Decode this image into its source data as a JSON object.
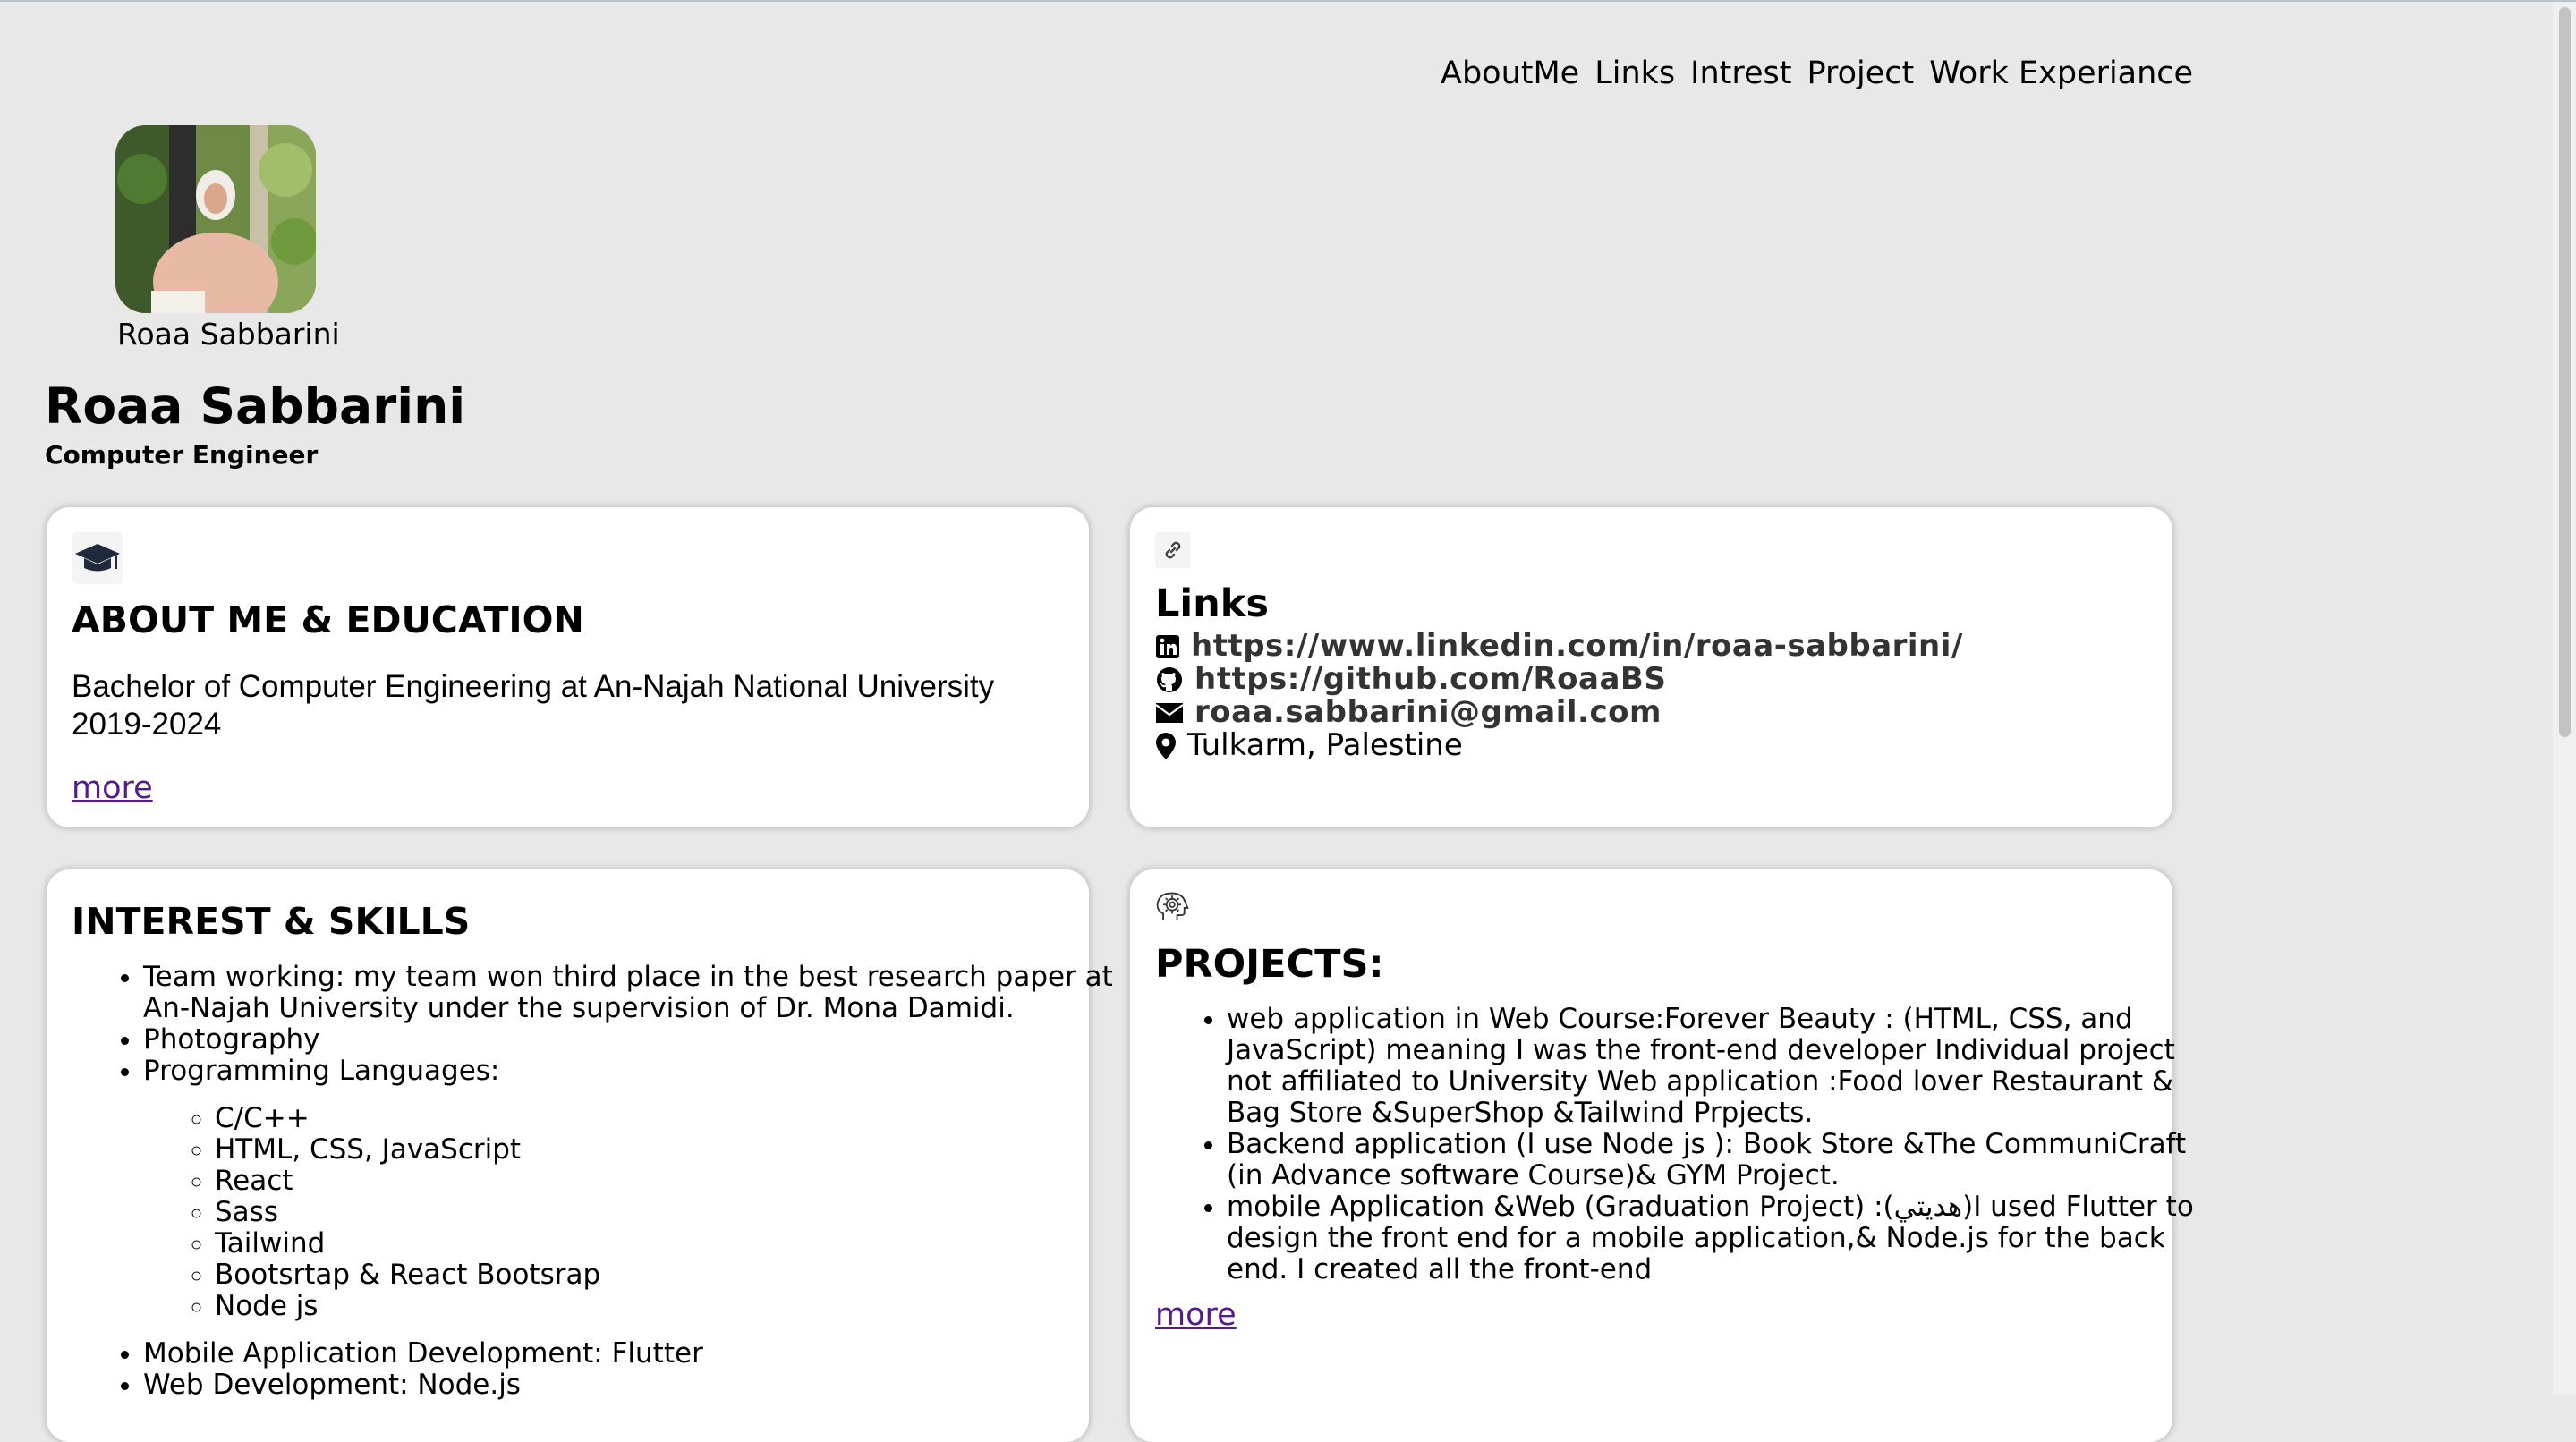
{
  "nav": {
    "items": [
      "AboutMe",
      "Links",
      "Intrest",
      "Project",
      "Work Experiance"
    ]
  },
  "profile": {
    "avatar_caption": "Roaa Sabbarini",
    "name": "Roaa Sabbarini",
    "title": "Computer Engineer"
  },
  "about": {
    "heading": "ABOUT ME & EDUCATION",
    "text": "Bachelor of Computer Engineering at An-Najah National University 2019-2024",
    "more": "more"
  },
  "links": {
    "heading": "Links",
    "linkedin": "https://www.linkedin.com/in/roaa-sabbarini/",
    "github": "https://github.com/RoaaBS",
    "email": "roaa.sabbarini@gmail.com",
    "location": "Tulkarm, Palestine"
  },
  "interest": {
    "heading": "INTEREST & SKILLS",
    "items": [
      "Team working: my team won third place in the best research paper at An-Najah University under the supervision of Dr. Mona Damidi.",
      "Photography",
      "Programming Languages:"
    ],
    "languages": [
      "C/C++",
      "HTML, CSS, JavaScript",
      "React",
      "Sass",
      "Tailwind",
      "Bootsrtap & React Bootsrap",
      "Node js"
    ],
    "items_after": [
      "Mobile Application Development: Flutter",
      "Web Development: Node.js"
    ]
  },
  "projects": {
    "heading": "PROJECTS:",
    "items": [
      "web application in Web Course:Forever Beauty : (HTML, CSS, and JavaScript) meaning I was the front-end developer Individual project not affiliated to University Web application :Food lover Restaurant & Bag Store &SuperShop &Tailwind Prpjects.",
      "Backend application (I use Node js ): Book Store &The CommuniCraft (in Advance software Course)& GYM Project.",
      "mobile Application &Web (Graduation Project) :(هديتي)I used Flutter to design the front end for a mobile application,& Node.js for the back end. I created all the front-end"
    ],
    "more": "more"
  },
  "colors": {
    "background": "#e8e8e8",
    "card": "#ffffff",
    "visited_link": "#551a8b",
    "scrollbar": "#c2c2c2"
  }
}
